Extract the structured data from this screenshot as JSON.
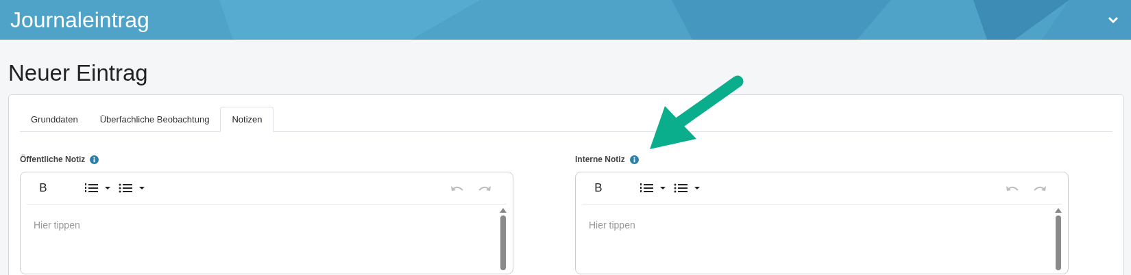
{
  "header": {
    "title": "Journaleintrag",
    "expanded": true
  },
  "page_title": "Neuer Eintrag",
  "tabs": [
    {
      "label": "Grunddaten",
      "selected": false
    },
    {
      "label": "Überfachliche Beobachtung",
      "selected": false
    },
    {
      "label": "Notizen",
      "selected": true
    }
  ],
  "editors": [
    {
      "label": "Öffentliche Notiz",
      "placeholder": "Hier tippen",
      "toolbar": {
        "bold": "B"
      }
    },
    {
      "label": "Interne Notiz",
      "placeholder": "Hier tippen",
      "toolbar": {
        "bold": "B"
      }
    }
  ]
}
